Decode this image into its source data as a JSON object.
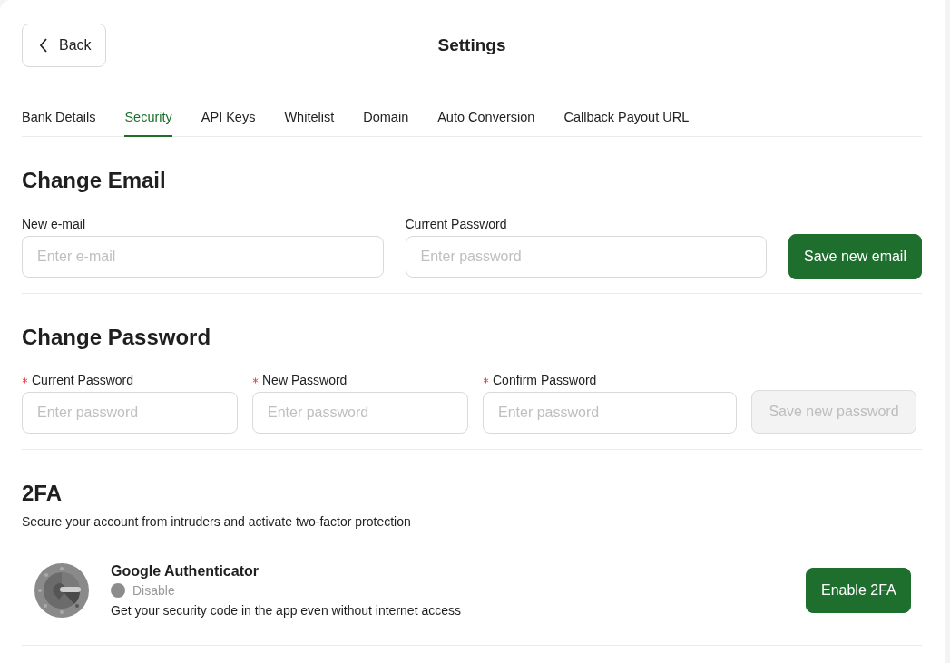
{
  "header": {
    "back_button": "Back",
    "title": "Settings"
  },
  "tabs": [
    {
      "label": "Bank Details",
      "selected": false
    },
    {
      "label": "Security",
      "selected": true
    },
    {
      "label": "API Keys",
      "selected": false
    },
    {
      "label": "Whitelist",
      "selected": false
    },
    {
      "label": "Domain",
      "selected": false
    },
    {
      "label": "Auto Conversion",
      "selected": false
    },
    {
      "label": "Callback Payout URL",
      "selected": false
    }
  ],
  "email_section": {
    "title": "Change Email",
    "fields": [
      {
        "label": "New e-mail",
        "placeholder": "Enter e-mail",
        "required": false
      },
      {
        "label": "Current Password",
        "placeholder": "Enter password",
        "required": false
      }
    ],
    "button": {
      "label": "Save new email",
      "disabled": false
    }
  },
  "password_section": {
    "title": "Change Password",
    "fields": [
      {
        "label": "Current Password",
        "placeholder": "Enter password",
        "required": true
      },
      {
        "label": "New Password",
        "placeholder": "Enter password",
        "required": true
      },
      {
        "label": "Confirm Password",
        "placeholder": "Enter password",
        "required": true
      }
    ],
    "button": {
      "label": "Save new password",
      "disabled": true
    }
  },
  "twofa_section": {
    "title": "2FA",
    "subtitle": "Secure your account from intruders and activate two-factor protection",
    "method": {
      "name": "Google Authenticator",
      "status": "Disable",
      "enabled": false,
      "description": "Get your security code in the app even without internet access",
      "button": "Enable 2FA"
    }
  }
}
